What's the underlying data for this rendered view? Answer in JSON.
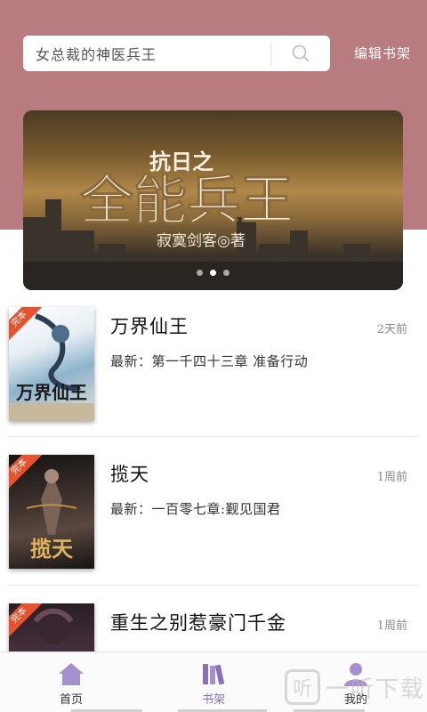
{
  "search": {
    "placeholder": "女总裁的神医兵王"
  },
  "header": {
    "edit_shelf_label": "编辑书架"
  },
  "banner": {
    "title_small": "抗日之",
    "title_big": "全能兵王",
    "author": "寂寞剑客◎著",
    "slide_count": 3,
    "active_slide": 1
  },
  "books": [
    {
      "title": "万界仙王",
      "time": "2天前",
      "latest": "最新：第一千四十三章 准备行动",
      "cover_badge": "完本",
      "cover_title": "万界仙王",
      "cover_colors": [
        "#f3f3f3",
        "#7ca8c8",
        "#2a3b52"
      ]
    },
    {
      "title": "揽天",
      "time": "1周前",
      "latest": "最新：一百零七章:觐见国君",
      "cover_badge": "完本",
      "cover_title": "揽天",
      "cover_colors": [
        "#1a1816",
        "#4a3a34",
        "#d6a34a"
      ]
    },
    {
      "title": "重生之别惹豪门千金",
      "time": "1周前",
      "latest": "",
      "cover_badge": "完本",
      "cover_title": "",
      "cover_colors": [
        "#2a1f26",
        "#4c3140",
        "#1a1418"
      ]
    }
  ],
  "tabs": [
    {
      "label": "首页",
      "icon": "home-icon",
      "active": false
    },
    {
      "label": "书架",
      "icon": "bookshelf-icon",
      "active": true
    },
    {
      "label": "我的",
      "icon": "user-icon",
      "active": false
    }
  ],
  "watermark": {
    "logo_char": "听",
    "text": "一听下载"
  },
  "colors": {
    "header": "#b87b7f",
    "accent": "#8b6fbf",
    "tab_icon": "#a490cf"
  }
}
